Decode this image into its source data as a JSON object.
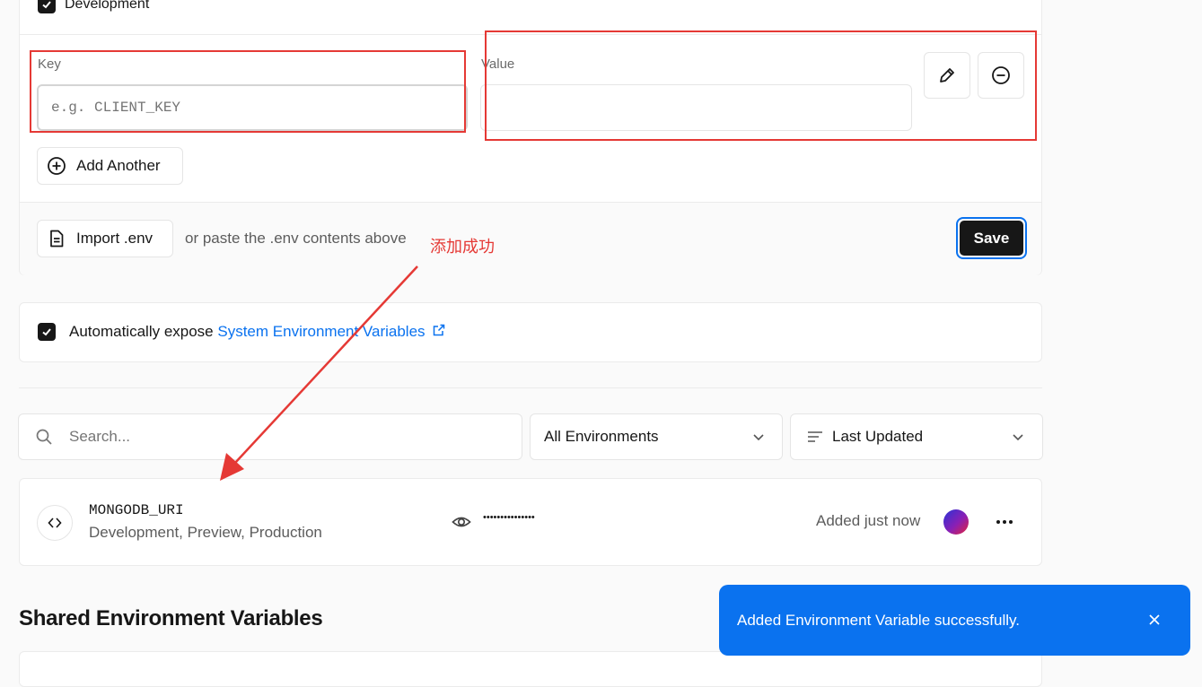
{
  "top_checkbox": {
    "label": "Development"
  },
  "form": {
    "key_label": "Key",
    "key_placeholder": "e.g. CLIENT_KEY",
    "value_label": "Value",
    "value_value": "",
    "add_another_label": "Add Another",
    "import_label": "Import .env",
    "paste_hint": "or paste the .env contents above",
    "save_label": "Save"
  },
  "annotation": {
    "text": "添加成功",
    "color": "#e53935"
  },
  "auto_expose": {
    "text": "Automatically expose",
    "link_text": "System Environment Variables"
  },
  "filters": {
    "search_placeholder": "Search...",
    "environment_value": "All Environments",
    "sort_value": "Last Updated"
  },
  "variables": [
    {
      "name": "MONGODB_URI",
      "environments": "Development, Preview, Production",
      "masked_value": "•••••••••••••••",
      "updated": "Added just now"
    }
  ],
  "shared_section": {
    "title": "Shared Environment Variables"
  },
  "toast": {
    "message": "Added Environment Variable successfully."
  },
  "colors": {
    "accent": "#0a72ef",
    "annotation": "#e53935",
    "dark": "#171717"
  },
  "icons": [
    "check-icon",
    "pencil-icon",
    "minus-circle-icon",
    "plus-circle-icon",
    "file-icon",
    "external-link-icon",
    "search-icon",
    "chevron-down-icon",
    "sort-lines-icon",
    "code-icon",
    "eye-icon",
    "avatar",
    "more-horizontal-icon",
    "close-icon"
  ]
}
